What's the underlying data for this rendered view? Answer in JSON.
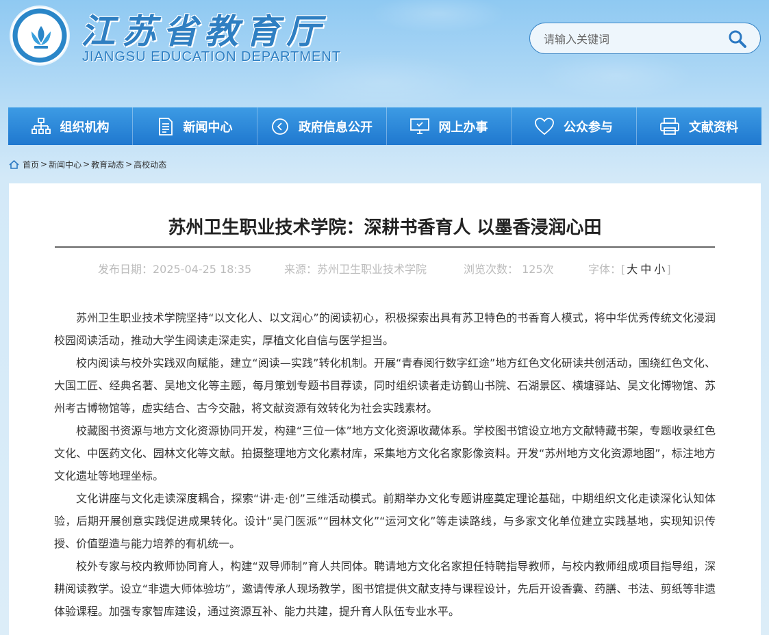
{
  "header": {
    "title_cn": "江苏省教育厅",
    "title_en": "JIANGSU EDUCATION DEPARTMENT",
    "search_placeholder": "请输入关键词"
  },
  "nav": {
    "items": [
      {
        "label": "组织机构",
        "icon": "org-chart-icon"
      },
      {
        "label": "新闻中心",
        "icon": "document-icon"
      },
      {
        "label": "政府信息公开",
        "icon": "play-circle-icon"
      },
      {
        "label": "网上办事",
        "icon": "monitor-icon"
      },
      {
        "label": "公众参与",
        "icon": "heart-icon"
      },
      {
        "label": "文献资料",
        "icon": "printer-icon"
      }
    ]
  },
  "breadcrumb": [
    "首页",
    "新闻中心",
    "教育动态",
    "高校动态"
  ],
  "article": {
    "title": "苏州卫生职业技术学院：深耕书香育人 以墨香浸润心田",
    "meta": {
      "date": "发布日期：2025-04-25 18:35",
      "source": "来源：苏州卫生职业技术学院",
      "views": "浏览次数： 125次",
      "font_label": "字体：",
      "font_large": "大",
      "font_medium": "中",
      "font_small": "小"
    },
    "paragraphs": [
      "苏州卫生职业技术学院坚持“以文化人、以文润心”的阅读初心，积极探索出具有苏卫特色的书香育人模式，将中华优秀传统文化浸润校园阅读活动，推动大学生阅读走深走实，厚植文化自信与医学担当。",
      "校内阅读与校外实践双向赋能，建立“阅读—实践”转化机制。开展“青春阅行数字红途”地方红色文化研读共创活动，围绕红色文化、大国工匠、经典名著、吴地文化等主题，每月策划专题书目荐读，同时组织读者走访鹤山书院、石湖景区、横塘驿站、吴文化博物馆、苏州考古博物馆等，虚实结合、古今交融，将文献资源有效转化为社会实践素材。",
      "校藏图书资源与地方文化资源协同开发，构建“三位一体”地方文化资源收藏体系。学校图书馆设立地方文献特藏书架，专题收录红色文化、中医药文化、园林文化等文献。拍摄整理地方文化素材库，采集地方文化名家影像资料。开发“苏州地方文化资源地图”，标注地方文化遗址等地理坐标。",
      "文化讲座与文化走读深度耦合，探索“讲·走·创”三维活动模式。前期举办文化专题讲座奠定理论基础，中期组织文化走读深化认知体验，后期开展创意实践促进成果转化。设计“吴门医派”“园林文化”“运河文化”等走读路线，与多家文化单位建立实践基地，实现知识传授、价值塑造与能力培养的有机统一。",
      "校外专家与校内教师协同育人，构建“双导师制”育人共同体。聘请地方文化名家担任特聘指导教师，与校内教师组成项目指导组，深耕阅读教学。设立“非遗大师体验坊”，邀请传承人现场教学，图书馆提供文献支持与课程设计，先后开设香囊、药膳、书法、剪纸等非遗体验课程。加强专家智库建设，通过资源互补、能力共建，提升育人队伍专业水平。"
    ]
  }
}
